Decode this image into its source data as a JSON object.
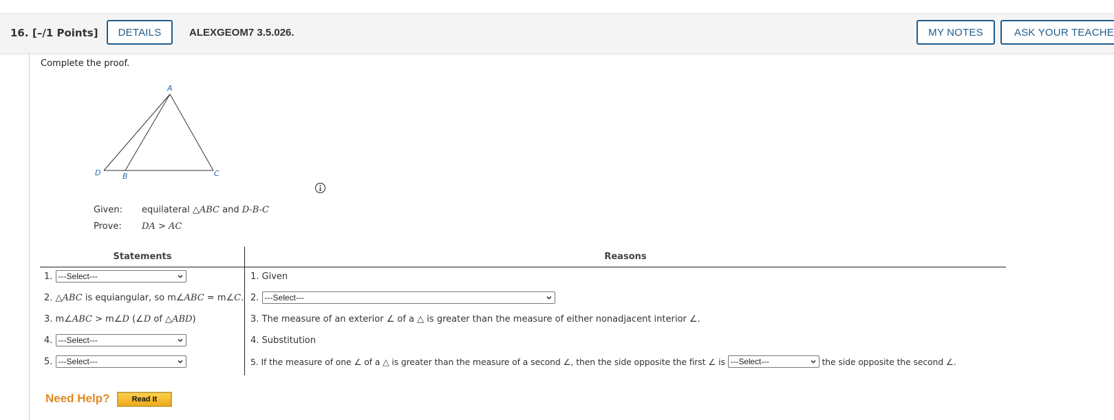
{
  "question": {
    "number": "16.",
    "points": "[–/1 Points]",
    "details_label": "DETAILS",
    "code": "ALEXGEOM7 3.5.026.",
    "my_notes_label": "MY NOTES",
    "ask_teacher_label": "ASK YOUR TEACHE"
  },
  "instructions": "Complete the proof.",
  "figure": {
    "label_a": "A",
    "label_b": "B",
    "label_c": "C",
    "label_d": "D",
    "label_color": "#2a6ab5"
  },
  "given": {
    "label": "Given:",
    "prefix": "equilateral △",
    "triangle": "ABC",
    "and": "and",
    "points": "D-B-C"
  },
  "prove": {
    "label": "Prove:",
    "left": "DA",
    "op": ">",
    "right": "AC"
  },
  "table": {
    "statements_header": "Statements",
    "reasons_header": "Reasons",
    "rows": [
      {
        "s_num": "1.",
        "s_select": "---Select---",
        "r_text": "1. Given"
      },
      {
        "s_num": "2.",
        "s_p1": "△",
        "s_tri": "ABC",
        "s_p2": "is equiangular, so m∠",
        "s_abc": "ABC",
        "s_p3": "= m∠",
        "s_c": "C",
        "s_p4": ".",
        "r_num": "2.",
        "r_select": "---Select---"
      },
      {
        "s_num": "3.",
        "s_p1": "m∠",
        "s_abc": "ABC",
        "s_p2": "> m∠",
        "s_d": "D",
        "s_p3": "(∠",
        "s_d2": "D",
        "s_p4": "of △",
        "s_abd": "ABD",
        "s_p5": ")",
        "r_text": "3. The measure of an exterior ∠ of a △ is greater than the measure of either nonadjacent interior ∠."
      },
      {
        "s_num": "4.",
        "s_select": "---Select---",
        "r_text": "4. Substitution"
      },
      {
        "s_num": "5.",
        "s_select": "---Select---",
        "r_before": "5. If the measure of one ∠ of a △ is greater than the measure of a second ∠, then the side opposite the first ∠ is",
        "r_select": "---Select---",
        "r_after": "the side opposite the second ∠."
      }
    ]
  },
  "help": {
    "need_help": "Need Help?",
    "read_it": "Read It"
  },
  "colors": {
    "accent_blue": "#1e5c8b",
    "help_orange": "#e08a1e",
    "button_gold": "#f0a81a"
  }
}
